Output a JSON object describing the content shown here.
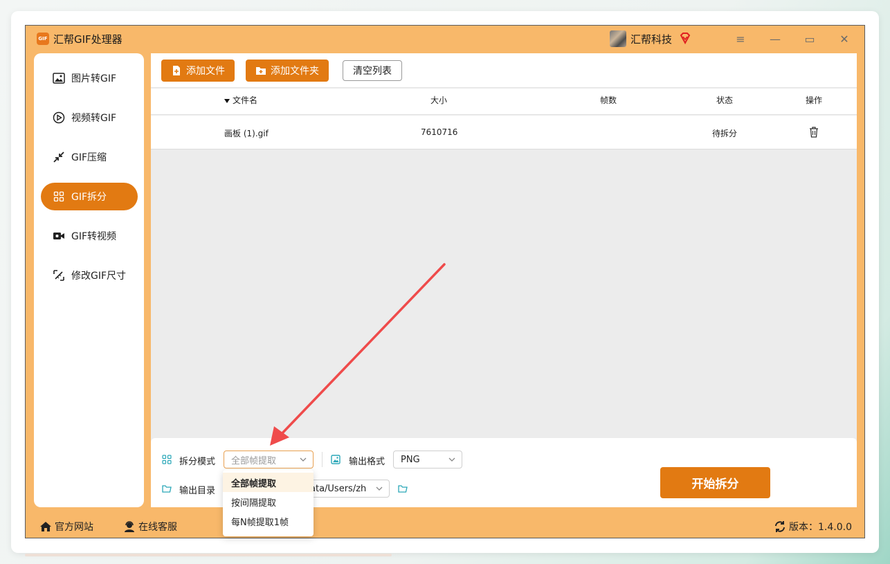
{
  "app": {
    "title": "汇帮GIF处理器",
    "logo_text": "GIF",
    "user_name": "汇帮科技",
    "accent": "#e27a12",
    "frame_color": "#f8b86a"
  },
  "window_controls": {
    "menu": "≡",
    "minimize": "—",
    "maximize": "▭",
    "close": "✕"
  },
  "sidebar": {
    "items": [
      {
        "label": "图片转GIF",
        "icon": "image-icon"
      },
      {
        "label": "视频转GIF",
        "icon": "play-icon"
      },
      {
        "label": "GIF压缩",
        "icon": "compress-icon"
      },
      {
        "label": "GIF拆分",
        "icon": "split-icon",
        "active": true
      },
      {
        "label": "GIF转视频",
        "icon": "video-camera-icon"
      },
      {
        "label": "修改GIF尺寸",
        "icon": "resize-icon"
      }
    ]
  },
  "toolbar": {
    "add_file": "添加文件",
    "add_folder": "添加文件夹",
    "clear_list": "清空列表"
  },
  "table": {
    "headers": {
      "name": "文件名",
      "size": "大小",
      "frames": "帧数",
      "status": "状态",
      "action": "操作"
    },
    "rows": [
      {
        "name": "画板 (1).gif",
        "size": "7610716",
        "frames": "",
        "status": "待拆分"
      }
    ]
  },
  "bottom": {
    "split_mode_label": "拆分模式",
    "split_mode_value": "全部帧提取",
    "output_format_label": "输出格式",
    "output_format_value": "PNG",
    "output_dir_label": "输出目录",
    "output_dir_value": "ata/Users/zh",
    "start_button": "开始拆分"
  },
  "split_mode_dropdown": {
    "options": [
      "全部帧提取",
      "按间隔提取",
      "每N帧提取1帧"
    ],
    "selected_index": 0
  },
  "footer": {
    "website": "官方网站",
    "support": "在线客服",
    "version": "版本：1.4.0.0"
  }
}
